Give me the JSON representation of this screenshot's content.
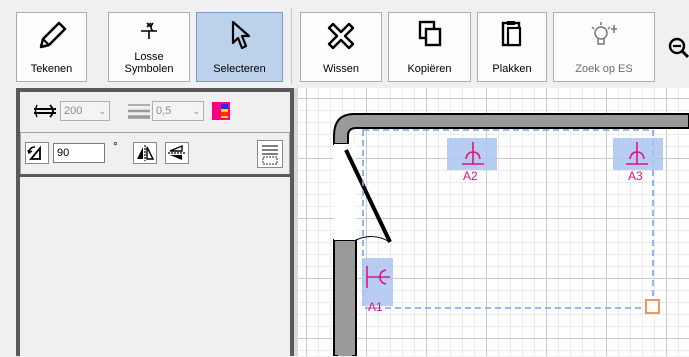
{
  "toolbar": {
    "buttons": [
      {
        "label": "Tekenen"
      },
      {
        "label": "Losse\nSymbolen"
      },
      {
        "label": "Selecteren"
      },
      {
        "label": "Wissen"
      },
      {
        "label": "Kopiëren"
      },
      {
        "label": "Plakken"
      },
      {
        "label": "Zoek op ES"
      }
    ],
    "line_losse": "Losse",
    "line_symbolen": "Symbolen",
    "active": "Selecteren"
  },
  "props": {
    "size_value": "200",
    "line_width_value": "0,5",
    "angle_value": "90",
    "degree_symbol": "°"
  },
  "symbols": [
    {
      "label": "A2"
    },
    {
      "label": "A3"
    },
    {
      "label": "A1"
    }
  ],
  "colors": {
    "selection": "#7aa0e8",
    "symbol": "#e0157d",
    "active_button": "#bcd2ea",
    "wall": "#9a9a9a"
  }
}
